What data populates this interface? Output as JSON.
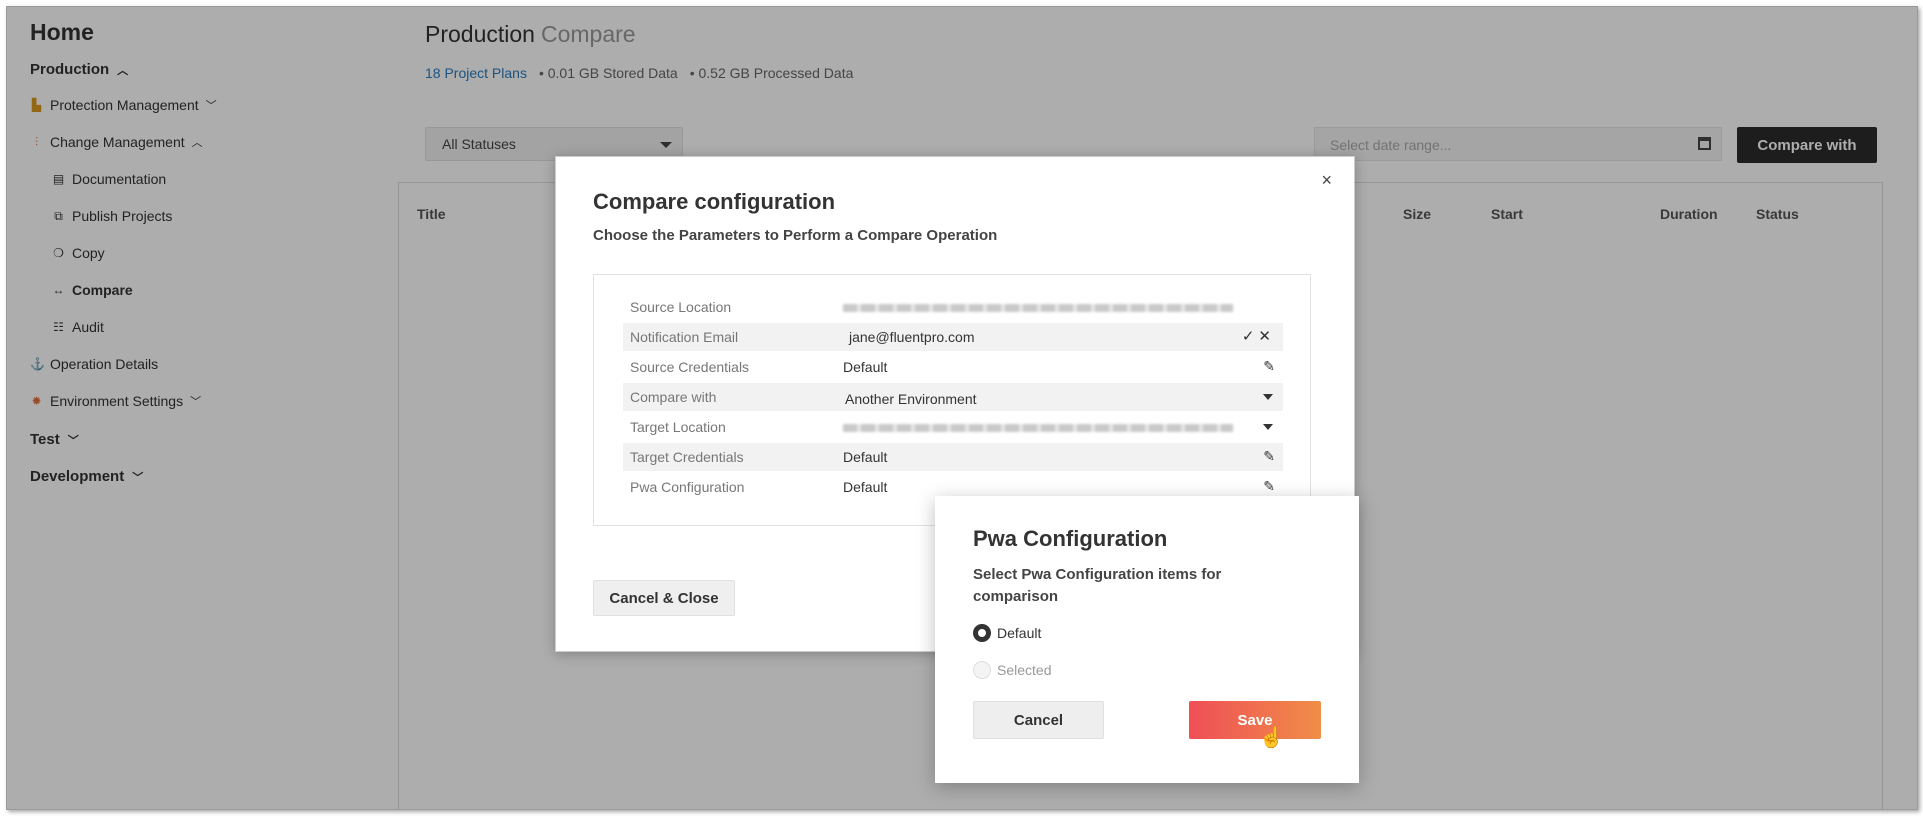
{
  "sidebar": {
    "home": "Home",
    "production": "Production",
    "protection_management": "Protection Management",
    "change_management": "Change Management",
    "documentation": "Documentation",
    "publish_projects": "Publish Projects",
    "copy": "Copy",
    "compare": "Compare",
    "audit": "Audit",
    "operation_details": "Operation Details",
    "environment_settings": "Environment Settings",
    "test": "Test",
    "development": "Development"
  },
  "main": {
    "title": "Production",
    "subtitle": "Compare",
    "stats": {
      "plans": "18 Project Plans",
      "stored": "• 0.01 GB Stored Data",
      "processed": "• 0.52 GB Processed Data"
    },
    "status_select": "All Statuses",
    "date_placeholder": "Select date range...",
    "compare_button": "Compare with",
    "table_headers": [
      "Title",
      "Size",
      "Start",
      "Duration",
      "Status"
    ]
  },
  "modal": {
    "title": "Compare configuration",
    "subtitle": "Choose the Parameters to Perform a Compare Operation",
    "rows": [
      {
        "label": "Source Location",
        "value": ""
      },
      {
        "label": "Notification Email",
        "value": "jane@fluentpro.com"
      },
      {
        "label": "Source Credentials",
        "value": "Default"
      },
      {
        "label": "Compare with",
        "value": "Another Environment"
      },
      {
        "label": "Target Location",
        "value": ""
      },
      {
        "label": "Target Credentials",
        "value": "Default"
      },
      {
        "label": "Pwa Configuration",
        "value": "Default"
      }
    ],
    "cancel_close": "Cancel & Close",
    "close_glyph": "×"
  },
  "pwa": {
    "title": "Pwa Configuration",
    "description": "Select Pwa Configuration items for comparison",
    "options": [
      {
        "label": "Default",
        "selected": true
      },
      {
        "label": "Selected",
        "selected": false
      }
    ],
    "cancel": "Cancel",
    "save": "Save"
  },
  "colors": {
    "link": "#2a7bbf",
    "save_gradient_start": "#ef4f56",
    "save_gradient_end": "#f08d48",
    "dark_button": "#2b2b2b"
  }
}
